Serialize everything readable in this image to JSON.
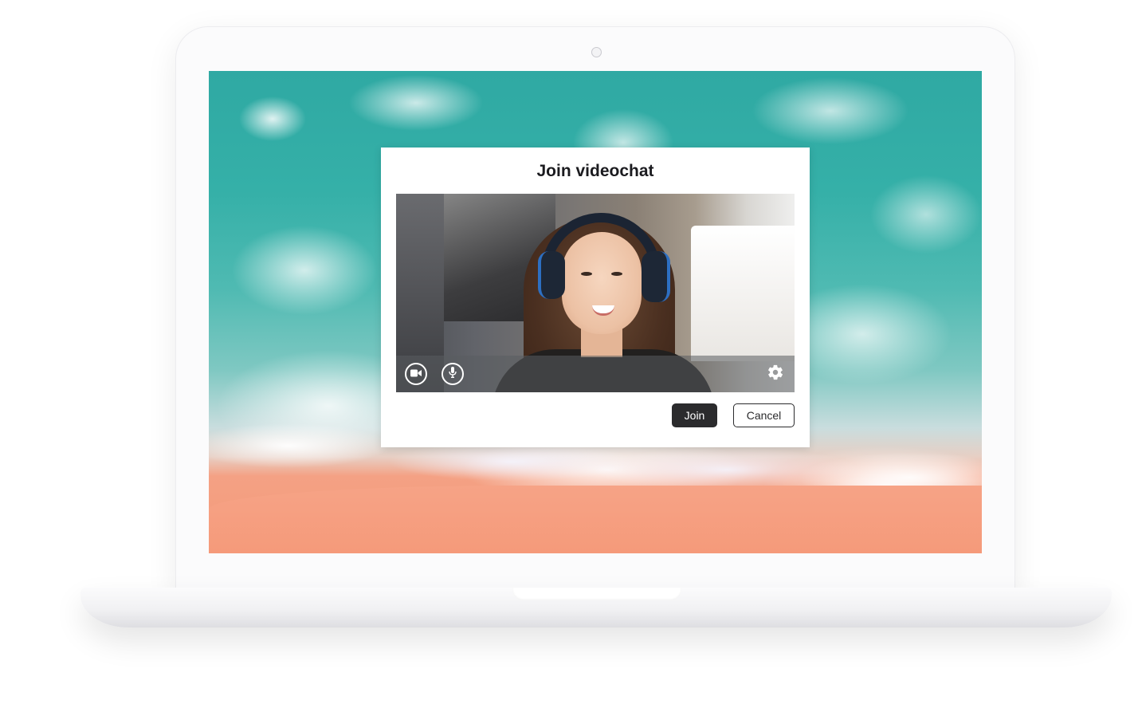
{
  "dialog": {
    "title": "Join videochat",
    "join_label": "Join",
    "cancel_label": "Cancel"
  },
  "video_controls": {
    "camera_icon": "video-camera-icon",
    "mic_icon": "microphone-icon",
    "settings_icon": "gear-icon"
  },
  "colors": {
    "primary_button": "#2b2b2d",
    "dialog_background": "#ffffff"
  }
}
